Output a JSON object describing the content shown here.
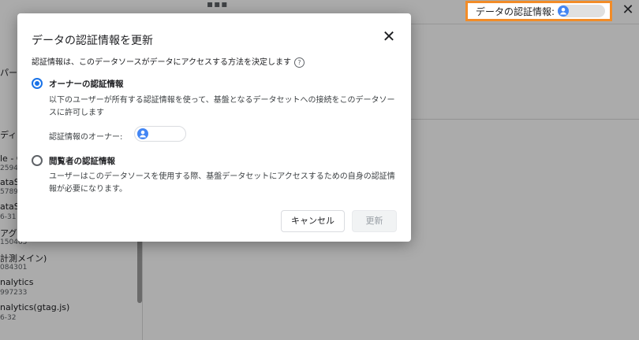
{
  "topbar": {
    "credentials_label": "データの認証情報:",
    "close_label": "✕"
  },
  "background_list": {
    "partial_label_top": "パー",
    "partial_col": "ディ",
    "items": [
      {
        "title": "le - G",
        "sub": "2594"
      },
      {
        "title": "ataS",
        "sub": "5789"
      },
      {
        "title": "ataS",
        "sub": "6-31"
      },
      {
        "title": "アグラ",
        "sub": "150465"
      },
      {
        "title": "計測メイン)",
        "sub": "084301"
      },
      {
        "title": "nalytics",
        "sub": "997233"
      },
      {
        "title": "nalytics(gtag.js)",
        "sub": "6-32"
      }
    ]
  },
  "dialog": {
    "title": "データの認証情報を更新",
    "close_label": "✕",
    "description": "認証情報は、このデータソースがデータにアクセスする方法を決定します",
    "help_glyph": "?",
    "options": [
      {
        "title": "オーナーの認証情報",
        "description": "以下のユーザーが所有する認証情報を使って、基盤となるデータセットへの接続をこのデータソースに許可します",
        "selected": true
      },
      {
        "title": "閲覧者の認証情報",
        "description": "ユーザーはこのデータソースを使用する際、基盤データセットにアクセスするための自身の認証情報が必要になります。",
        "selected": false
      }
    ],
    "owner_label": "認証情報のオーナー:",
    "cancel_label": "キャンセル",
    "update_label": "更新"
  },
  "colors": {
    "accent": "#1a73e8",
    "highlight_border": "#f28c28",
    "overlay": "rgba(0,0,0,0.33)"
  },
  "icons": {
    "avatar": "account-circle-icon",
    "help": "help-circle-icon",
    "close": "close-icon"
  }
}
